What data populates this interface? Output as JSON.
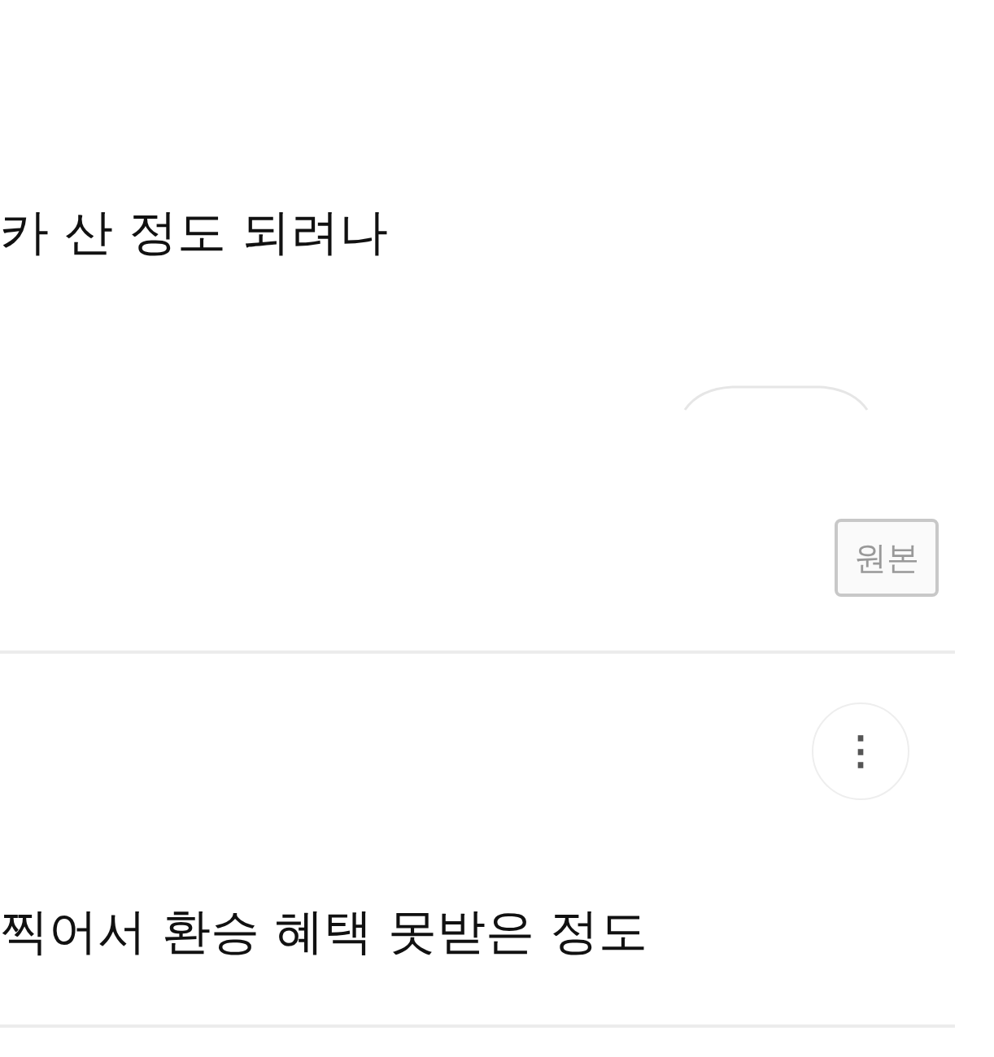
{
  "posts": [
    {
      "text": "카 산 정도 되려나",
      "original_button": "원본"
    },
    {
      "text": "찍어서 환승 혜택 못받은 정도",
      "more_button": "⋮"
    }
  ]
}
